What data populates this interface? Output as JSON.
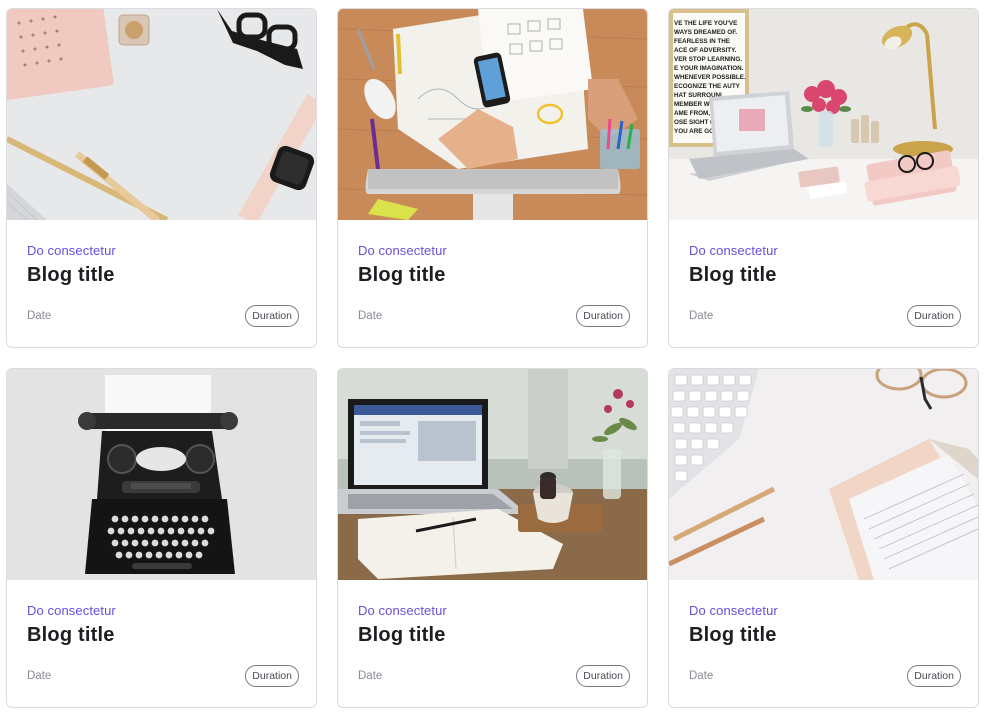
{
  "cards": [
    {
      "category": "Do consectetur",
      "title": "Blog title",
      "date": "Date",
      "duration": "Duration",
      "image": "desk-flatlay-watch-glasses"
    },
    {
      "category": "Do consectetur",
      "title": "Blog title",
      "date": "Date",
      "duration": "Duration",
      "image": "desk-phone-sketches"
    },
    {
      "category": "Do consectetur",
      "title": "Blog title",
      "date": "Date",
      "duration": "Duration",
      "image": "desk-laptop-lamp-poster",
      "poster_text": [
        "VE THE LIFE YOU'VE",
        "WAYS DREAMED OF.",
        "FEARLESS IN THE",
        "ACE OF ADVERSITY.",
        "VER STOP LEARNING.",
        "E YOUR IMAGINATION.",
        "WHENEVER POSSIBLE.",
        "ECOGNIZE THE   AUTY",
        "HAT SURROUNI",
        "MEMBER WHI",
        "AME FROM, BU",
        "OSE SIGHT OF",
        "YOU ARE GO"
      ]
    },
    {
      "category": "Do consectetur",
      "title": "Blog title",
      "date": "Date",
      "duration": "Duration",
      "image": "typewriter"
    },
    {
      "category": "Do consectetur",
      "title": "Blog title",
      "date": "Date",
      "duration": "Duration",
      "image": "laptop-notebook-coffee"
    },
    {
      "category": "Do consectetur",
      "title": "Blog title",
      "date": "Date",
      "duration": "Duration",
      "image": "keyboard-pens-notebook"
    }
  ],
  "colors": {
    "accent": "#6b4fd8",
    "title": "#1d1d22",
    "muted": "#8a8a92"
  }
}
